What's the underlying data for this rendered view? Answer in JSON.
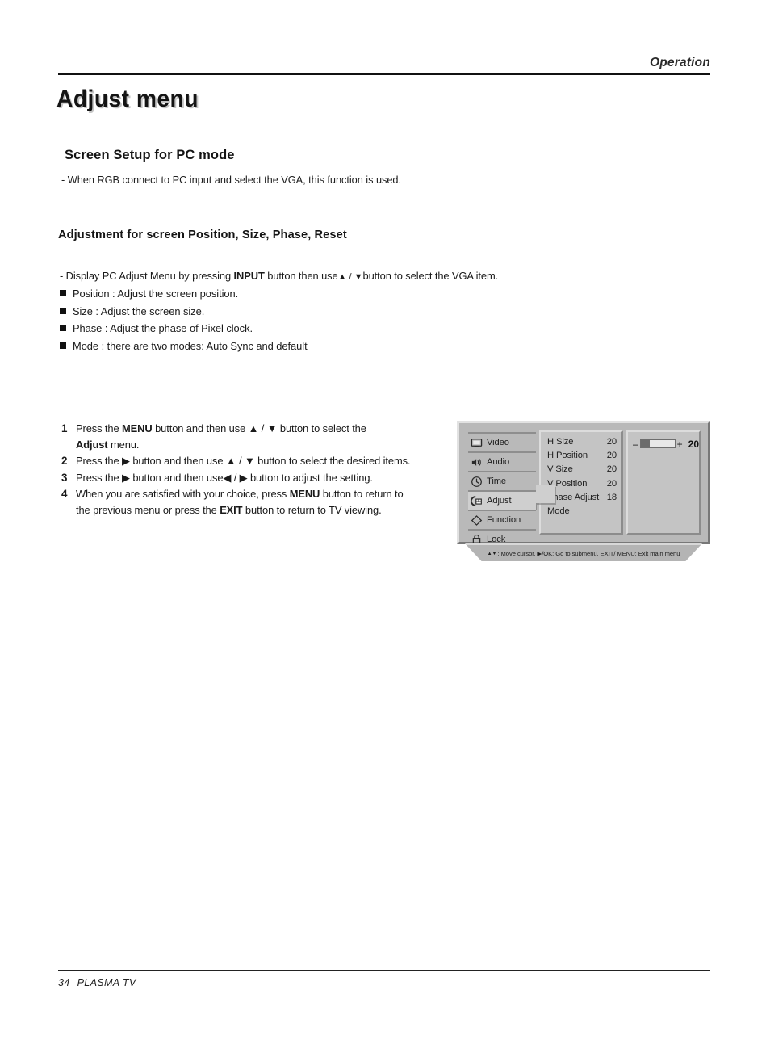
{
  "header": {
    "running_head": "Operation"
  },
  "title": "Adjust menu",
  "section": {
    "heading": "Screen Setup for PC mode",
    "note": "- When RGB connect to PC input and select the VGA, this function is used."
  },
  "subsection": {
    "heading": "Adjustment for screen Position, Size, Phase, Reset",
    "intro_prefix": "- Display PC Adjust Menu by pressing ",
    "intro_bold1": "INPUT",
    "intro_mid": " button then use",
    "intro_arrows": "▲ / ▼",
    "intro_suffix": "button to select the VGA item.",
    "bullets": [
      "Position : Adjust the screen position.",
      "Size : Adjust the screen size.",
      "Phase : Adjust the phase of Pixel clock.",
      "Mode : there are two modes: Auto Sync and default"
    ]
  },
  "steps": [
    {
      "num": "1",
      "parts": [
        {
          "t": "Press the ",
          "b": false
        },
        {
          "t": "MENU",
          "b": true
        },
        {
          "t": " button and then use ",
          "b": false
        },
        {
          "t": "▲ / ▼",
          "b": false
        },
        {
          "t": " button to select the",
          "b": false
        },
        {
          "t": "BR",
          "b": false
        },
        {
          "t": "Adjust",
          "b": true
        },
        {
          "t": " menu.",
          "b": false
        }
      ]
    },
    {
      "num": "2",
      "parts": [
        {
          "t": "Press the ",
          "b": false
        },
        {
          "t": "▶",
          "b": false
        },
        {
          "t": " button and then use ",
          "b": false
        },
        {
          "t": "▲ / ▼",
          "b": false
        },
        {
          "t": " button to select the desired items.",
          "b": false
        }
      ]
    },
    {
      "num": "3",
      "parts": [
        {
          "t": "Press the ",
          "b": false
        },
        {
          "t": "▶",
          "b": false
        },
        {
          "t": " button and then use",
          "b": false
        },
        {
          "t": "◀ / ▶",
          "b": false
        },
        {
          "t": " button to adjust the setting.",
          "b": false
        }
      ]
    },
    {
      "num": "4",
      "parts": [
        {
          "t": "When you are satisfied with your choice,  press ",
          "b": false
        },
        {
          "t": "MENU",
          "b": true
        },
        {
          "t": " button to return to",
          "b": false
        },
        {
          "t": "BR",
          "b": false
        },
        {
          "t": "the previous menu or press the ",
          "b": false
        },
        {
          "t": "EXIT",
          "b": true
        },
        {
          "t": " button to return to TV viewing.",
          "b": false
        }
      ]
    }
  ],
  "osd": {
    "sidebar": [
      {
        "label": "Video",
        "icon": "video-screen-icon",
        "selected": false
      },
      {
        "label": "Audio",
        "icon": "speaker-icon",
        "selected": false
      },
      {
        "label": "Time",
        "icon": "clock-icon",
        "selected": false
      },
      {
        "label": "Adjust",
        "icon": "adjust-icon",
        "selected": true
      },
      {
        "label": "Function",
        "icon": "tag-icon",
        "selected": false
      },
      {
        "label": "Lock",
        "icon": "padlock-icon",
        "selected": false
      }
    ],
    "items": [
      {
        "label": "H Size",
        "value": "20"
      },
      {
        "label": "H Position",
        "value": "20"
      },
      {
        "label": "V Size",
        "value": "20"
      },
      {
        "label": "V Position",
        "value": "20"
      },
      {
        "label": "Phase Adjust",
        "value": "18"
      },
      {
        "label": "Mode",
        "value": ""
      }
    ],
    "slider": {
      "minus": "–",
      "plus": "+",
      "value": "20",
      "fill_percent": 8
    },
    "hint": ": Move cursor,  ▶/OK: Go to submenu, EXIT/ MENU: Exit main menu",
    "hint_updown": "▲▼",
    "colors": {
      "panel": "#b9b9b9",
      "column": "#c4c4c4",
      "highlight": "#cfcfcf",
      "thumb": "#6b6b6b"
    }
  },
  "footer": {
    "page_number": "34",
    "product": "PLASMA TV"
  }
}
